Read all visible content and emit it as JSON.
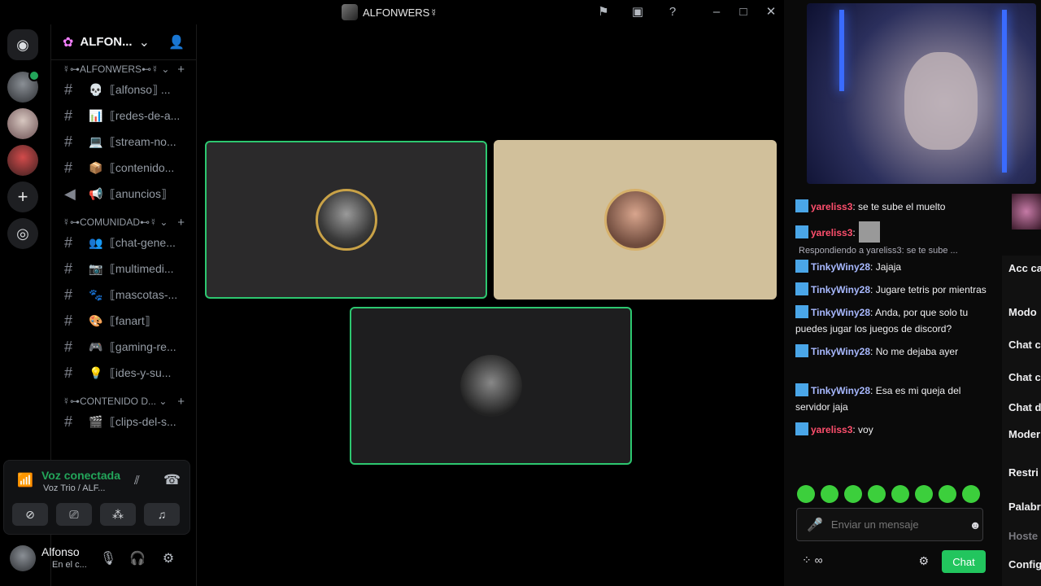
{
  "window": {
    "title": "ALFONWERS☿"
  },
  "titlebar_icons": [
    "flag-icon",
    "inbox-icon",
    "help-icon"
  ],
  "server_rail": {
    "home_label": "Discord",
    "add_label": "+"
  },
  "server": {
    "name": "ALFON...",
    "invite_icon": "add-person-icon"
  },
  "categories": [
    {
      "label": "☿⊶ALFONWERS⊷☿ ⌄",
      "channels": [
        {
          "emoji": "💀",
          "name": "⟦alfonso⟧ ..."
        },
        {
          "emoji": "📊",
          "name": "⟦redes-de-a..."
        },
        {
          "emoji": "💻",
          "name": "⟦stream-no..."
        },
        {
          "emoji": "📦",
          "name": "⟦contenido..."
        },
        {
          "emoji": "📢",
          "name": "⟦anuncios⟧",
          "hash": "📢"
        }
      ]
    },
    {
      "label": "☿⊶COMUNIDAD⊷☿ ⌄",
      "channels": [
        {
          "emoji": "👥",
          "name": "⟦chat-gene..."
        },
        {
          "emoji": "📷",
          "name": "⟦multimedi..."
        },
        {
          "emoji": "🐾",
          "name": "⟦mascotas-..."
        },
        {
          "emoji": "🎨",
          "name": "⟦fanart⟧"
        },
        {
          "emoji": "🎮",
          "name": "⟦gaming-re..."
        },
        {
          "emoji": "💡",
          "name": "⟦ides-y-su..."
        }
      ]
    },
    {
      "label": "☿⊶CONTENIDO D... ⌄",
      "channels": [
        {
          "emoji": "🎬",
          "name": "⟦clips-del-s..."
        }
      ]
    }
  ],
  "voice": {
    "status": "Voz conectada",
    "channel": "Voz Trio / ALF..."
  },
  "user": {
    "name": "Alfonso",
    "status": "En el c..."
  },
  "chat": {
    "messages": [
      {
        "user": "yareliss3",
        "color": "pink",
        "text": ": se te sube el muelto"
      },
      {
        "user": "yareliss3",
        "color": "pink",
        "text": ":"
      },
      {
        "reply": "Respondiendo a yareliss3: se te sube ..."
      },
      {
        "user": "TinkyWiny28",
        "color": "blue",
        "text": ": Jajaja"
      },
      {
        "user": "TinkyWiny28",
        "color": "blue",
        "text": ": Jugare tetris por mientras"
      },
      {
        "user": "TinkyWiny28",
        "color": "blue",
        "text": ": Anda, por que solo tu puedes jugar los juegos de discord?"
      },
      {
        "user": "TinkyWiny28",
        "color": "blue",
        "text": ": No me dejaba ayer"
      },
      {
        "user": "TinkyWiny28",
        "color": "blue",
        "text": ": Esa es mi queja del servidor jaja"
      },
      {
        "user": "yareliss3",
        "color": "pink",
        "text": ": voy"
      }
    ],
    "input_placeholder": "Enviar un mensaje",
    "send_label": "Chat"
  },
  "mod_panel": [
    "Acc car",
    "Modo",
    "Chat c",
    "Chat c",
    "Chat d",
    "Moder con IA",
    "Restri",
    "Palabr",
    "Hoste",
    "Config"
  ],
  "colors": {
    "speaking_border": "#2dc770",
    "send_button": "#22c55e",
    "voice_green": "#23a55a"
  }
}
